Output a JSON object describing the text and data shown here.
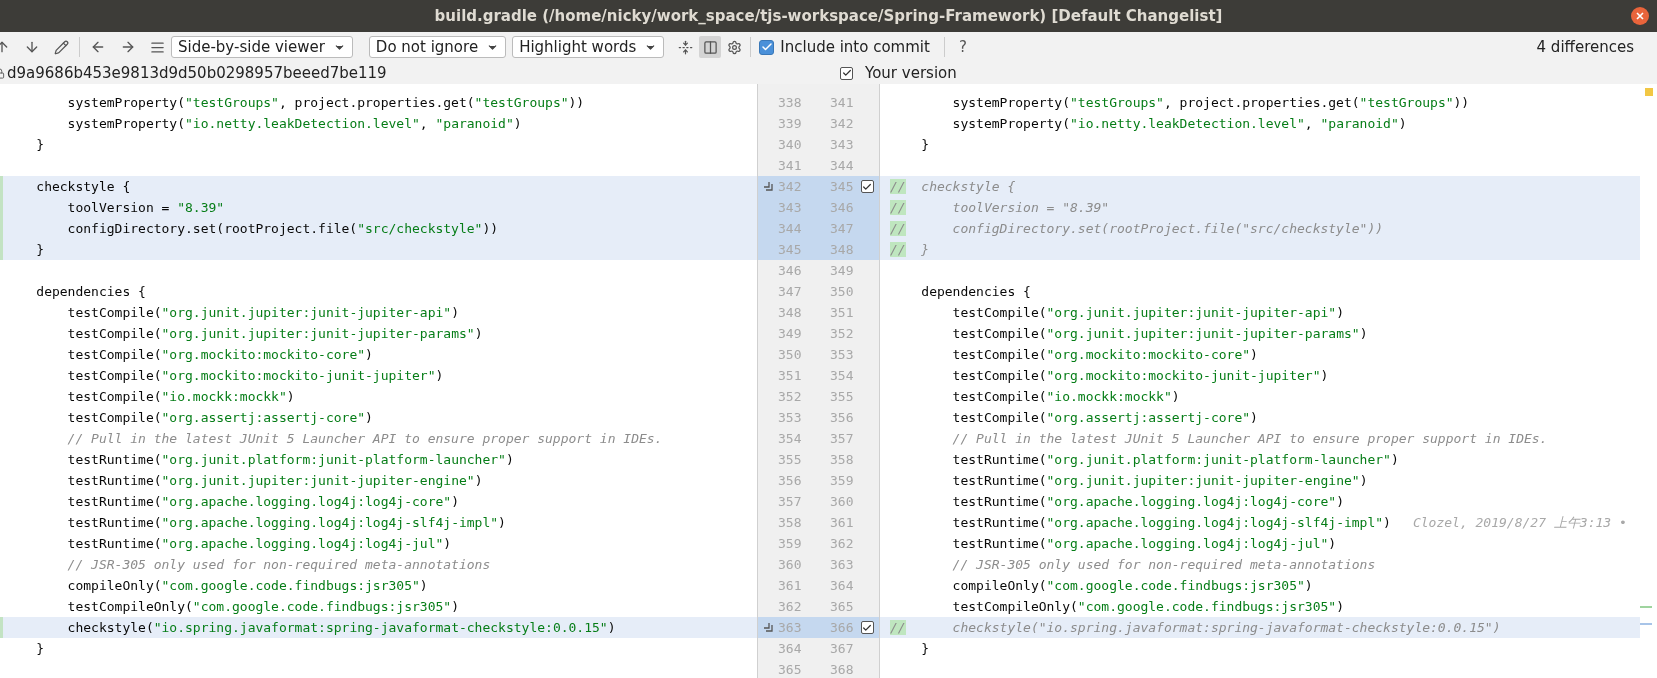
{
  "window": {
    "title": "build.gradle (/home/nicky/work_space/tjs-workspace/Spring-Framework) [Default Changelist]"
  },
  "toolbar": {
    "dropdowns": [
      "Side-by-side viewer",
      "Do not ignore",
      "Highlight words"
    ],
    "split_toggle": {
      "selected": true
    },
    "include_checkbox": {
      "label": "Include into commit",
      "checked": true
    },
    "help": "?",
    "differences": "4 differences"
  },
  "left_header": {
    "revision": "d9a9686b453e9813d9d50b0298957beeed7be119"
  },
  "right_header": {
    "label": "Your version",
    "checked": true
  },
  "rows": [
    {
      "kind": "plain",
      "left_number": "338",
      "right_number": "341",
      "left": [
        {
          "kind": "text",
          "text": "        systemProperty("
        },
        {
          "kind": "string",
          "text": "\"testGroups\""
        },
        {
          "kind": "text",
          "text": ", project.properties.get("
        },
        {
          "kind": "string",
          "text": "\"testGroups\""
        },
        {
          "kind": "text",
          "text": "))"
        }
      ],
      "right": [
        {
          "kind": "text",
          "text": "        systemProperty("
        },
        {
          "kind": "string",
          "text": "\"testGroups\""
        },
        {
          "kind": "text",
          "text": ", project.properties.get("
        },
        {
          "kind": "string",
          "text": "\"testGroups\""
        },
        {
          "kind": "text",
          "text": "))"
        }
      ]
    },
    {
      "kind": "plain",
      "left_number": "339",
      "right_number": "342",
      "left": [
        {
          "kind": "text",
          "text": "        systemProperty("
        },
        {
          "kind": "string",
          "text": "\"io.netty.leakDetection.level\""
        },
        {
          "kind": "text",
          "text": ", "
        },
        {
          "kind": "string",
          "text": "\"paranoid\""
        },
        {
          "kind": "text",
          "text": ")"
        }
      ],
      "right": [
        {
          "kind": "text",
          "text": "        systemProperty("
        },
        {
          "kind": "string",
          "text": "\"io.netty.leakDetection.level\""
        },
        {
          "kind": "text",
          "text": ", "
        },
        {
          "kind": "string",
          "text": "\"paranoid\""
        },
        {
          "kind": "text",
          "text": ")"
        }
      ]
    },
    {
      "kind": "plain",
      "left_number": "340",
      "right_number": "343",
      "left": [
        {
          "kind": "text",
          "text": "    }"
        }
      ],
      "right": [
        {
          "kind": "text",
          "text": "    }"
        }
      ]
    },
    {
      "kind": "plain",
      "left_number": "341",
      "right_number": "344",
      "left": [],
      "right": []
    },
    {
      "kind": "changed",
      "change": {
        "included": true
      },
      "left_number": "342",
      "right_number": "345",
      "left": [
        {
          "kind": "text",
          "text": "    checkstyle {"
        }
      ],
      "right": [
        {
          "kind": "inserted",
          "text": "//"
        },
        {
          "kind": "comment",
          "text": "  checkstyle {"
        }
      ]
    },
    {
      "kind": "changed",
      "left_number": "343",
      "right_number": "346",
      "left": [
        {
          "kind": "text",
          "text": "        toolVersion = "
        },
        {
          "kind": "string",
          "text": "\"8.39\""
        }
      ],
      "right": [
        {
          "kind": "inserted",
          "text": "//"
        },
        {
          "kind": "comment",
          "text": "      toolVersion = \"8.39\""
        }
      ]
    },
    {
      "kind": "changed",
      "left_number": "344",
      "right_number": "347",
      "left": [
        {
          "kind": "text",
          "text": "        configDirectory.set(rootProject.file("
        },
        {
          "kind": "string",
          "text": "\"src/checkstyle\""
        },
        {
          "kind": "text",
          "text": "))"
        }
      ],
      "right": [
        {
          "kind": "inserted",
          "text": "//"
        },
        {
          "kind": "comment",
          "text": "      configDirectory.set(rootProject.file(\"src/checkstyle\"))"
        }
      ]
    },
    {
      "kind": "changed",
      "left_number": "345",
      "right_number": "348",
      "left": [
        {
          "kind": "text",
          "text": "    }"
        }
      ],
      "right": [
        {
          "kind": "inserted",
          "text": "//"
        },
        {
          "kind": "comment",
          "text": "  }"
        }
      ]
    },
    {
      "kind": "plain",
      "left_number": "346",
      "right_number": "349",
      "left": [],
      "right": []
    },
    {
      "kind": "plain",
      "left_number": "347",
      "right_number": "350",
      "left": [
        {
          "kind": "text",
          "text": "    dependencies {"
        }
      ],
      "right": [
        {
          "kind": "text",
          "text": "    dependencies {"
        }
      ]
    },
    {
      "kind": "plain",
      "left_number": "348",
      "right_number": "351",
      "left": [
        {
          "kind": "text",
          "text": "        testCompile("
        },
        {
          "kind": "string",
          "text": "\"org.junit.jupiter:junit-jupiter-api\""
        },
        {
          "kind": "text",
          "text": ")"
        }
      ],
      "right": [
        {
          "kind": "text",
          "text": "        testCompile("
        },
        {
          "kind": "string",
          "text": "\"org.junit.jupiter:junit-jupiter-api\""
        },
        {
          "kind": "text",
          "text": ")"
        }
      ]
    },
    {
      "kind": "plain",
      "left_number": "349",
      "right_number": "352",
      "left": [
        {
          "kind": "text",
          "text": "        testCompile("
        },
        {
          "kind": "string",
          "text": "\"org.junit.jupiter:junit-jupiter-params\""
        },
        {
          "kind": "text",
          "text": ")"
        }
      ],
      "right": [
        {
          "kind": "text",
          "text": "        testCompile("
        },
        {
          "kind": "string",
          "text": "\"org.junit.jupiter:junit-jupiter-params\""
        },
        {
          "kind": "text",
          "text": ")"
        }
      ]
    },
    {
      "kind": "plain",
      "left_number": "350",
      "right_number": "353",
      "left": [
        {
          "kind": "text",
          "text": "        testCompile("
        },
        {
          "kind": "string",
          "text": "\"org.mockito:mockito-core\""
        },
        {
          "kind": "text",
          "text": ")"
        }
      ],
      "right": [
        {
          "kind": "text",
          "text": "        testCompile("
        },
        {
          "kind": "string",
          "text": "\"org.mockito:mockito-core\""
        },
        {
          "kind": "text",
          "text": ")"
        }
      ]
    },
    {
      "kind": "plain",
      "left_number": "351",
      "right_number": "354",
      "left": [
        {
          "kind": "text",
          "text": "        testCompile("
        },
        {
          "kind": "string",
          "text": "\"org.mockito:mockito-junit-jupiter\""
        },
        {
          "kind": "text",
          "text": ")"
        }
      ],
      "right": [
        {
          "kind": "text",
          "text": "        testCompile("
        },
        {
          "kind": "string",
          "text": "\"org.mockito:mockito-junit-jupiter\""
        },
        {
          "kind": "text",
          "text": ")"
        }
      ]
    },
    {
      "kind": "plain",
      "left_number": "352",
      "right_number": "355",
      "left": [
        {
          "kind": "text",
          "text": "        testCompile("
        },
        {
          "kind": "string",
          "text": "\"io.mockk:mockk\""
        },
        {
          "kind": "text",
          "text": ")"
        }
      ],
      "right": [
        {
          "kind": "text",
          "text": "        testCompile("
        },
        {
          "kind": "string",
          "text": "\"io.mockk:mockk\""
        },
        {
          "kind": "text",
          "text": ")"
        }
      ]
    },
    {
      "kind": "plain",
      "left_number": "353",
      "right_number": "356",
      "left": [
        {
          "kind": "text",
          "text": "        testCompile("
        },
        {
          "kind": "string",
          "text": "\"org.assertj:assertj-core\""
        },
        {
          "kind": "text",
          "text": ")"
        }
      ],
      "right": [
        {
          "kind": "text",
          "text": "        testCompile("
        },
        {
          "kind": "string",
          "text": "\"org.assertj:assertj-core\""
        },
        {
          "kind": "text",
          "text": ")"
        }
      ]
    },
    {
      "kind": "plain",
      "left_number": "354",
      "right_number": "357",
      "left": [
        {
          "kind": "comment",
          "text": "        // Pull in the latest JUnit 5 Launcher API to ensure proper support in IDEs."
        }
      ],
      "right": [
        {
          "kind": "comment",
          "text": "        // Pull in the latest JUnit 5 Launcher API to ensure proper support in IDEs."
        }
      ]
    },
    {
      "kind": "plain",
      "left_number": "355",
      "right_number": "358",
      "left": [
        {
          "kind": "text",
          "text": "        testRuntime("
        },
        {
          "kind": "string",
          "text": "\"org.junit.platform:junit-platform-launcher\""
        },
        {
          "kind": "text",
          "text": ")"
        }
      ],
      "right": [
        {
          "kind": "text",
          "text": "        testRuntime("
        },
        {
          "kind": "string",
          "text": "\"org.junit.platform:junit-platform-launcher\""
        },
        {
          "kind": "text",
          "text": ")"
        }
      ]
    },
    {
      "kind": "plain",
      "left_number": "356",
      "right_number": "359",
      "left": [
        {
          "kind": "text",
          "text": "        testRuntime("
        },
        {
          "kind": "string",
          "text": "\"org.junit.jupiter:junit-jupiter-engine\""
        },
        {
          "kind": "text",
          "text": ")"
        }
      ],
      "right": [
        {
          "kind": "text",
          "text": "        testRuntime("
        },
        {
          "kind": "string",
          "text": "\"org.junit.jupiter:junit-jupiter-engine\""
        },
        {
          "kind": "text",
          "text": ")"
        }
      ]
    },
    {
      "kind": "plain",
      "left_number": "357",
      "right_number": "360",
      "left": [
        {
          "kind": "text",
          "text": "        testRuntime("
        },
        {
          "kind": "string",
          "text": "\"org.apache.logging.log4j:log4j-core\""
        },
        {
          "kind": "text",
          "text": ")"
        }
      ],
      "right": [
        {
          "kind": "text",
          "text": "        testRuntime("
        },
        {
          "kind": "string",
          "text": "\"org.apache.logging.log4j:log4j-core\""
        },
        {
          "kind": "text",
          "text": ")"
        }
      ]
    },
    {
      "kind": "plain",
      "left_number": "358",
      "right_number": "361",
      "left": [
        {
          "kind": "text",
          "text": "        testRuntime("
        },
        {
          "kind": "string",
          "text": "\"org.apache.logging.log4j:log4j-slf4j-impl\""
        },
        {
          "kind": "text",
          "text": ")"
        }
      ],
      "right": [
        {
          "kind": "text",
          "text": "        testRuntime("
        },
        {
          "kind": "string",
          "text": "\"org.apache.logging.log4j:log4j-slf4j-impl\""
        },
        {
          "kind": "text",
          "text": ")"
        }
      ],
      "annotation": "Clozel, 2019/8/27 上午3:13 •"
    },
    {
      "kind": "plain",
      "left_number": "359",
      "right_number": "362",
      "left": [
        {
          "kind": "text",
          "text": "        testRuntime("
        },
        {
          "kind": "string",
          "text": "\"org.apache.logging.log4j:log4j-jul\""
        },
        {
          "kind": "text",
          "text": ")"
        }
      ],
      "right": [
        {
          "kind": "text",
          "text": "        testRuntime("
        },
        {
          "kind": "string",
          "text": "\"org.apache.logging.log4j:log4j-jul\""
        },
        {
          "kind": "text",
          "text": ")"
        }
      ]
    },
    {
      "kind": "plain",
      "left_number": "360",
      "right_number": "363",
      "left": [
        {
          "kind": "comment",
          "text": "        // JSR-305 only used for non-required meta-annotations"
        }
      ],
      "right": [
        {
          "kind": "comment",
          "text": "        // JSR-305 only used for non-required meta-annotations"
        }
      ]
    },
    {
      "kind": "plain",
      "left_number": "361",
      "right_number": "364",
      "left": [
        {
          "kind": "text",
          "text": "        compileOnly("
        },
        {
          "kind": "string",
          "text": "\"com.google.code.findbugs:jsr305\""
        },
        {
          "kind": "text",
          "text": ")"
        }
      ],
      "right": [
        {
          "kind": "text",
          "text": "        compileOnly("
        },
        {
          "kind": "string",
          "text": "\"com.google.code.findbugs:jsr305\""
        },
        {
          "kind": "text",
          "text": ")"
        }
      ]
    },
    {
      "kind": "plain",
      "left_number": "362",
      "right_number": "365",
      "left": [
        {
          "kind": "text",
          "text": "        testCompileOnly("
        },
        {
          "kind": "string",
          "text": "\"com.google.code.findbugs:jsr305\""
        },
        {
          "kind": "text",
          "text": ")"
        }
      ],
      "right": [
        {
          "kind": "text",
          "text": "        testCompileOnly("
        },
        {
          "kind": "string",
          "text": "\"com.google.code.findbugs:jsr305\""
        },
        {
          "kind": "text",
          "text": ")"
        }
      ]
    },
    {
      "kind": "changed",
      "change": {
        "included": true
      },
      "left_number": "363",
      "right_number": "366",
      "left": [
        {
          "kind": "text",
          "text": "        checkstyle("
        },
        {
          "kind": "string",
          "text": "\"io.spring.javaformat:spring-javaformat-checkstyle:0.0.15\""
        },
        {
          "kind": "text",
          "text": ")"
        }
      ],
      "right": [
        {
          "kind": "inserted",
          "text": "//"
        },
        {
          "kind": "comment",
          "text": "      checkstyle(\"io.spring.javaformat:spring-javaformat-checkstyle:0.0.15\")"
        }
      ]
    },
    {
      "kind": "plain",
      "left_number": "364",
      "right_number": "367",
      "left": [
        {
          "kind": "text",
          "text": "    }"
        }
      ],
      "right": [
        {
          "kind": "text",
          "text": "    }"
        }
      ]
    },
    {
      "kind": "plain",
      "left_number": "365",
      "right_number": "368",
      "left": [],
      "right": []
    }
  ]
}
